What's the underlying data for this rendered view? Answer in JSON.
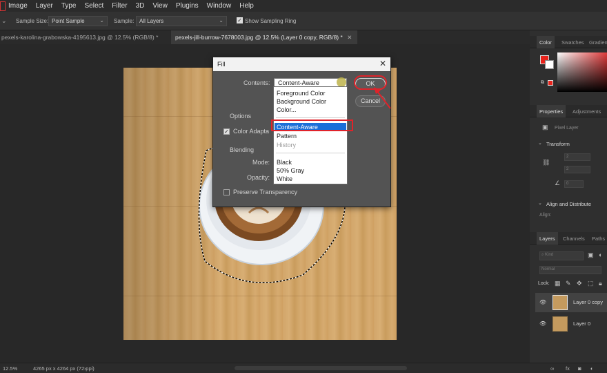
{
  "menubar": {
    "items": [
      "Image",
      "Layer",
      "Type",
      "Select",
      "Filter",
      "3D",
      "View",
      "Plugins",
      "Window",
      "Help"
    ]
  },
  "options": {
    "sample_size_label": "Sample Size:",
    "sample_size_value": "Point Sample",
    "sample_label": "Sample:",
    "sample_value": "All Layers",
    "show_ring_label": "Show Sampling Ring"
  },
  "tabs": [
    {
      "label": "pexels-karolina-grabowska-4195613.jpg @ 12.5% (RGB/8) *",
      "active": false
    },
    {
      "label": "pexels-jill-burrow-7678003.jpg @ 12.5% (Layer 0 copy, RGB/8) *",
      "active": true
    }
  ],
  "dialog": {
    "title": "Fill",
    "close": "✕",
    "contents_label": "Contents:",
    "contents_value": "Content-Aware",
    "ok_label": "OK",
    "cancel_label": "Cancel",
    "options_label": "Options",
    "color_adapt_label": "Color Adapta",
    "blending_label": "Blending",
    "mode_label": "Mode:",
    "opacity_label": "Opacity:",
    "preserve_label": "Preserve Transparency"
  },
  "dropdown": {
    "items": [
      {
        "label": "Foreground Color",
        "state": "normal"
      },
      {
        "label": "Background Color",
        "state": "normal"
      },
      {
        "label": "Color...",
        "state": "normal"
      },
      {
        "label": "Content-Aware",
        "state": "selected"
      },
      {
        "label": "Pattern",
        "state": "normal"
      },
      {
        "label": "History",
        "state": "disabled"
      },
      {
        "label": "Black",
        "state": "normal"
      },
      {
        "label": "50% Gray",
        "state": "normal"
      },
      {
        "label": "White",
        "state": "normal"
      }
    ]
  },
  "panels": {
    "color_tabs": [
      "Color",
      "Swatches",
      "Gradien"
    ],
    "props_tabs": [
      "Properties",
      "Adjustments"
    ],
    "pixel_layer": "Pixel Layer",
    "transform": "Transform",
    "align": "Align and Distribute",
    "align_sub": "Align:",
    "layers_tabs": [
      "Layers",
      "Channels",
      "Paths"
    ],
    "kind_placeholder": "Kind",
    "blend_mode": "Normal",
    "lock_label": "Lock:",
    "layers": [
      {
        "name": "Layer 0 copy",
        "active": true
      },
      {
        "name": "Layer 0",
        "active": false
      }
    ],
    "fg_color": "#e8231b",
    "bg_color": "#ffffff"
  },
  "status": {
    "zoom": "12.5%",
    "doc_info": "4265 px x 4264 px (72 ppi)"
  }
}
